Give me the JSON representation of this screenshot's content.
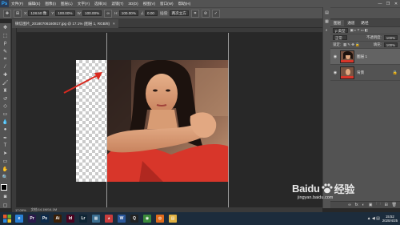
{
  "app": {
    "logo": "Ps"
  },
  "menu": [
    "文件(F)",
    "编辑(E)",
    "图像(I)",
    "图层(L)",
    "文字(Y)",
    "选择(S)",
    "滤镜(T)",
    "3D(D)",
    "视图(V)",
    "窗口(W)",
    "帮助(H)"
  ],
  "window_controls": {
    "minimize": "—",
    "restore": "❐",
    "close": "✕"
  },
  "options_bar": {
    "x_label": "X:",
    "x_value": "128.50 像",
    "y_label": "Y:",
    "y_value": "100.00%",
    "w_label": "W:",
    "w_value": "100.00%",
    "h_label": "H:",
    "h_value": "100.00%",
    "angle_value": "0.00",
    "interp_label": "插值:",
    "interp_value": "两次立方"
  },
  "document_tab": {
    "title": "微信图片_20180706160817.jpg @ 17.1% (图层 1, RGB/8)",
    "close": "×"
  },
  "status_bar": {
    "zoom": "17.09%",
    "doc_size": "文档:14.1M/14.1M"
  },
  "layers_panel": {
    "tabs": [
      "图层",
      "通道",
      "路径"
    ],
    "filter_label": "ρ 类型",
    "blend_mode": "正常",
    "opacity_label": "不透明度:",
    "opacity_value": "100%",
    "lock_label": "锁定:",
    "fill_label": "填充:",
    "fill_value": "100%",
    "layers": [
      {
        "name": "图层 1",
        "selected": true
      },
      {
        "name": "背景",
        "selected": false
      }
    ],
    "footer_icons": [
      "fx",
      "◐",
      "▣",
      "🗀",
      "⊞",
      "🗑"
    ]
  },
  "watermark": {
    "brand": "Baidu",
    "product": "经验",
    "url": "jingyan.baidu.com"
  },
  "taskbar": {
    "apps": [
      {
        "name": "ie",
        "label": "e",
        "color": "#2a7fd4"
      },
      {
        "name": "premiere",
        "label": "Pr",
        "color": "#2a1a4a"
      },
      {
        "name": "photoshop",
        "label": "Ps",
        "color": "#0d2a4a"
      },
      {
        "name": "illustrator",
        "label": "Ai",
        "color": "#3a1e06"
      },
      {
        "name": "indesign",
        "label": "Id",
        "color": "#49021f"
      },
      {
        "name": "lightroom",
        "label": "Lr",
        "color": "#0e2433"
      },
      {
        "name": "app-grid",
        "label": "▦",
        "color": "#3a6d8f"
      },
      {
        "name": "media",
        "label": "◕",
        "color": "#c83c3c"
      },
      {
        "name": "word",
        "label": "W",
        "color": "#2b579a"
      },
      {
        "name": "qq",
        "label": "Q",
        "color": "#222222"
      },
      {
        "name": "chrome",
        "label": "◉",
        "color": "#3a8a3a"
      },
      {
        "name": "firefox",
        "label": "◍",
        "color": "#e06a1a"
      },
      {
        "name": "folder",
        "label": "▤",
        "color": "#e0b040"
      }
    ],
    "clock_time": "15:52",
    "clock_date": "2020/4/25"
  }
}
